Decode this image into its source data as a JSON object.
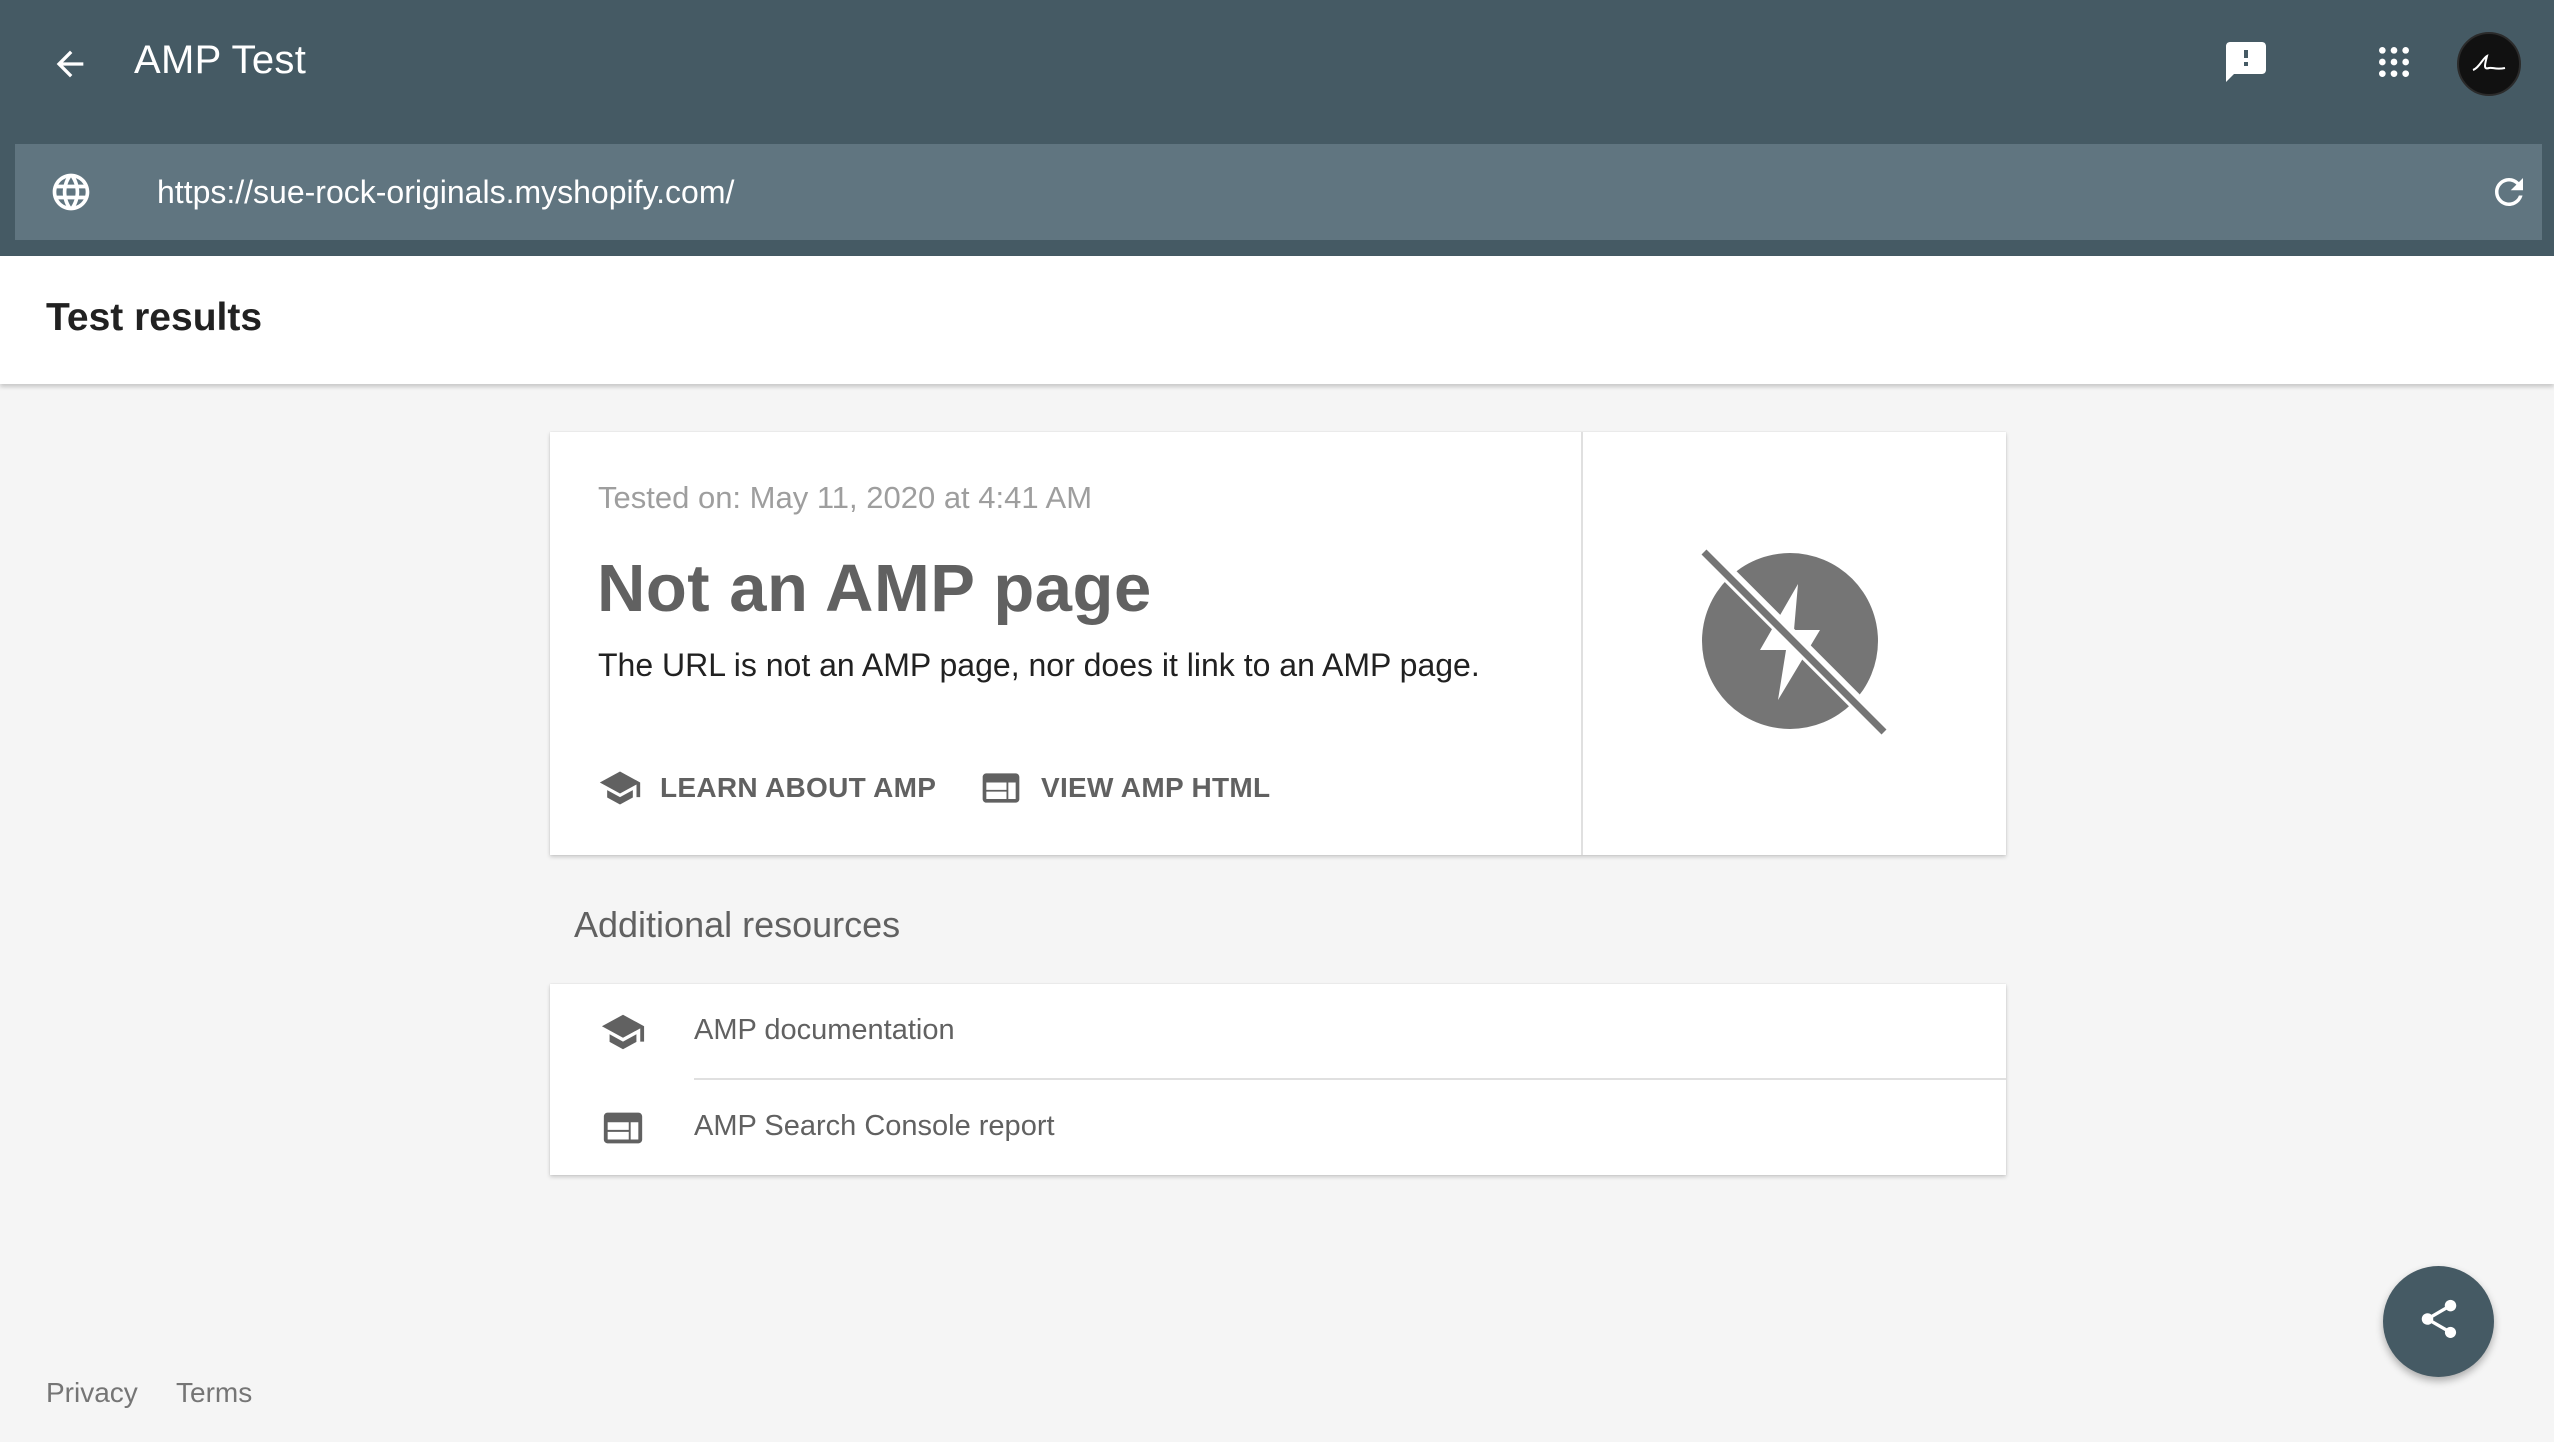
{
  "appbar": {
    "title": "AMP Test",
    "icons": [
      "back-arrow-icon",
      "feedback-icon",
      "apps-grid-icon",
      "avatar"
    ]
  },
  "urlbar": {
    "url": "https://sue-rock-originals.myshopify.com/",
    "icons": [
      "globe-icon",
      "reload-icon"
    ]
  },
  "results": {
    "heading": "Test results"
  },
  "verdict": {
    "tested_on": "Tested on: May 11, 2020 at 4:41 AM",
    "title": "Not an AMP page",
    "description": "The URL is not an AMP page, nor does it link to an AMP page.",
    "learn_label": "LEARN ABOUT AMP",
    "view_label": "VIEW AMP HTML",
    "status_icon": "amp-disabled-icon"
  },
  "resources": {
    "title": "Additional resources",
    "items": [
      {
        "label": "AMP documentation",
        "icon": "school-icon"
      },
      {
        "label": "AMP Search Console report",
        "icon": "web-layout-icon"
      }
    ]
  },
  "footer": {
    "privacy": "Privacy",
    "terms": "Terms"
  },
  "fab": {
    "icon": "share-icon"
  },
  "colors": {
    "appbar": "#455a64",
    "urlbar": "#607580",
    "background": "#f5f5f5",
    "icon_gray": "#757575"
  }
}
